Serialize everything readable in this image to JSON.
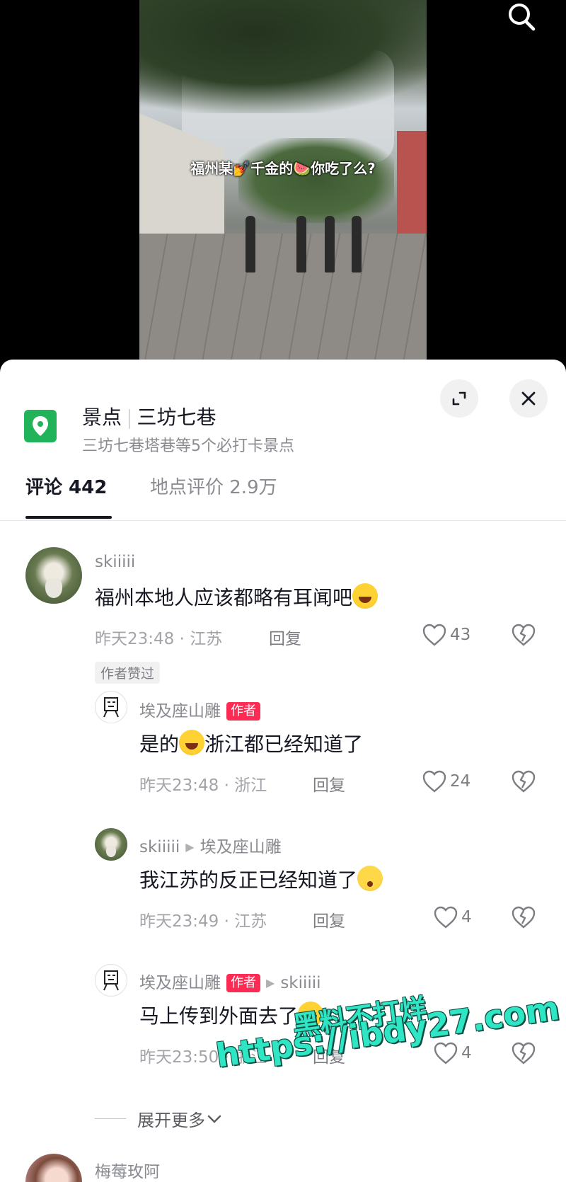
{
  "video": {
    "caption": "福州某💅千金的🍉你吃了么?"
  },
  "place": {
    "category": "景点",
    "name": "三坊七巷",
    "subtitle": "三坊七巷塔巷等5个必打卡景点"
  },
  "tabs": [
    {
      "label": "评论 442",
      "active": true
    },
    {
      "label": "地点评价 2.9万",
      "active": false
    }
  ],
  "comments": [
    {
      "user": "skiiiii",
      "text": "福州本地人应该都略有耳闻吧",
      "meta": "昨天23:48 · 江苏",
      "reply_label": "回复",
      "likes": "43",
      "badge": "作者赞过"
    },
    {
      "user": "埃及座山雕",
      "author_tag": "作者",
      "text_a": "是的",
      "text_b": "浙江都已经知道了",
      "meta": "昨天23:48 · 浙江",
      "reply_label": "回复",
      "likes": "24"
    },
    {
      "user": "skiiiii",
      "reply_to": "埃及座山雕",
      "text": "我江苏的反正已经知道了",
      "meta": "昨天23:49 · 江苏",
      "reply_label": "回复",
      "likes": "4"
    },
    {
      "user": "埃及座山雕",
      "author_tag": "作者",
      "reply_to": "skiiiii",
      "text": "马上传到外面去了",
      "meta": "昨天23:50 · 浙江",
      "reply_label": "回复",
      "likes": "4"
    },
    {
      "user": "梅莓玫阿"
    }
  ],
  "expand_more": "展开更多",
  "watermark": {
    "line1": "黑料不打烊",
    "line2": "https://ibdy27.com"
  },
  "colors": {
    "accent_author": "#fe2c55",
    "place_icon": "#20b35a",
    "watermark": "#2ee5c4"
  },
  "icons": [
    "search-icon",
    "location-pin-icon",
    "expand-icon",
    "close-icon",
    "heart-icon",
    "dislike-icon",
    "chevron-down-icon"
  ]
}
